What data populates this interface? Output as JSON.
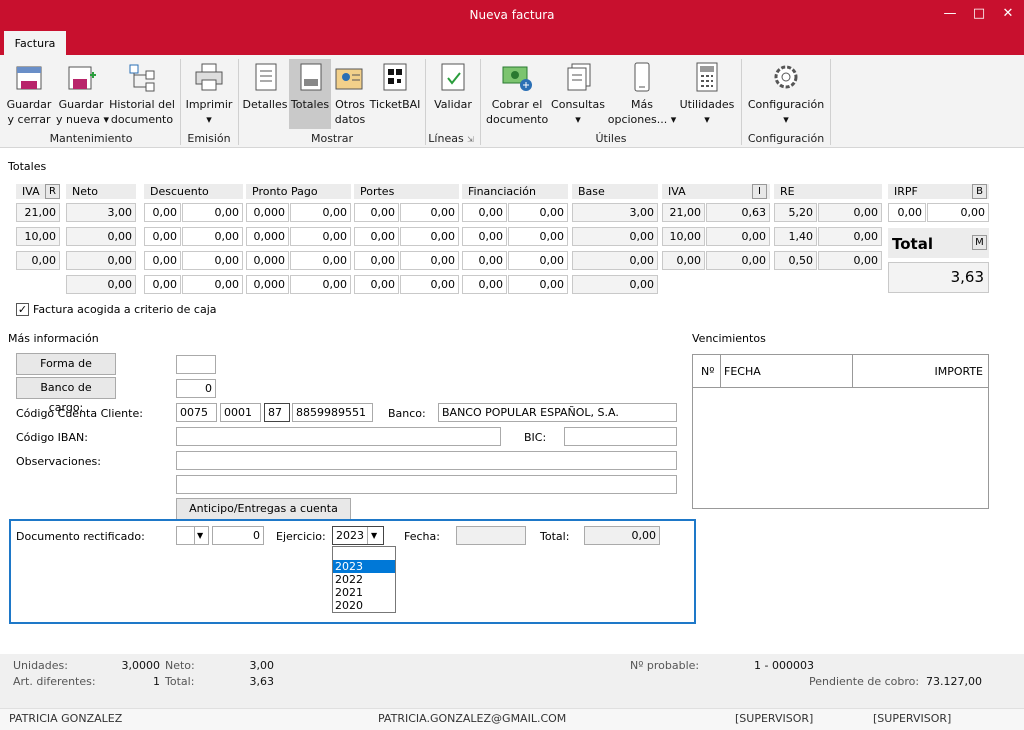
{
  "window": {
    "title": "Nueva factura"
  },
  "tabs": {
    "active": "Factura"
  },
  "ribbon": {
    "guardar_cerrar": "Guardar\ny cerrar",
    "guardar_nueva": "Guardar\ny nueva ▾",
    "historial": "Historial del\ndocumento",
    "imprimir": "Imprimir\n▾",
    "detalles": "Detalles",
    "totales": "Totales",
    "otros_datos": "Otros\ndatos",
    "ticketbai": "TicketBAI",
    "validar": "Validar",
    "cobrar": "Cobrar el\ndocumento",
    "consultas": "Consultas\n▾",
    "mas_opciones": "Más\nopciones... ▾",
    "utilidades": "Utilidades\n▾",
    "configuracion": "Configuración\n▾",
    "groups": {
      "mantenimiento": "Mantenimiento",
      "emision": "Emisión",
      "mostrar": "Mostrar",
      "lineas": "Líneas",
      "utiles": "Útiles",
      "configuracion": "Configuración"
    }
  },
  "totales": {
    "section_title": "Totales",
    "headers": {
      "iva": "IVA",
      "r": "R",
      "neto": "Neto",
      "descuento": "Descuento",
      "pronto_pago": "Pronto Pago",
      "portes": "Portes",
      "financiacion": "Financiación",
      "base": "Base",
      "iva2": "IVA",
      "i": "I",
      "re": "RE",
      "irpf": "IRPF",
      "b": "B"
    },
    "rows": [
      {
        "iva": "21,00",
        "neto": "3,00",
        "d1": "0,00",
        "d2": "0,00",
        "pp1": "0,000",
        "pp2": "0,00",
        "po1": "0,00",
        "po2": "0,00",
        "f1": "0,00",
        "f2": "0,00",
        "base": "3,00",
        "iva_pct": "21,00",
        "iva_imp": "0,63",
        "re_pct": "5,20",
        "re_imp": "0,00"
      },
      {
        "iva": "10,00",
        "neto": "0,00",
        "d1": "0,00",
        "d2": "0,00",
        "pp1": "0,000",
        "pp2": "0,00",
        "po1": "0,00",
        "po2": "0,00",
        "f1": "0,00",
        "f2": "0,00",
        "base": "0,00",
        "iva_pct": "10,00",
        "iva_imp": "0,00",
        "re_pct": "1,40",
        "re_imp": "0,00"
      },
      {
        "iva": "0,00",
        "neto": "0,00",
        "d1": "0,00",
        "d2": "0,00",
        "pp1": "0,000",
        "pp2": "0,00",
        "po1": "0,00",
        "po2": "0,00",
        "f1": "0,00",
        "f2": "0,00",
        "base": "0,00",
        "iva_pct": "0,00",
        "iva_imp": "0,00",
        "re_pct": "0,50",
        "re_imp": "0,00"
      },
      {
        "neto": "0,00",
        "d1": "0,00",
        "d2": "0,00",
        "pp1": "0,000",
        "pp2": "0,00",
        "po1": "0,00",
        "po2": "0,00",
        "f1": "0,00",
        "f2": "0,00",
        "base": "0,00"
      }
    ],
    "irpf_pct": "0,00",
    "irpf_imp": "0,00",
    "total_label": "Total",
    "total_m": "M",
    "total_value": "3,63",
    "criterio_caja": "Factura acogida a criterio de caja"
  },
  "info": {
    "section_title": "Más información",
    "forma_pago_btn": "Forma de pago:",
    "forma_pago_val": "",
    "banco_cargo_btn": "Banco de cargo:",
    "banco_cargo_val": "0",
    "cuenta_label": "Código Cuenta Cliente:",
    "cc1": "0075",
    "cc2": "0001",
    "cc3": "87",
    "cc4": "8859989551",
    "banco_label": "Banco:",
    "banco_val": "BANCO POPULAR ESPAÑOL, S.A.",
    "iban_label": "Código IBAN:",
    "bic_label": "BIC:",
    "obs_label": "Observaciones:",
    "anticipo_btn": "Anticipo/Entregas a cuenta"
  },
  "vencimientos": {
    "title": "Vencimientos",
    "col_n": "Nº",
    "col_fecha": "FECHA",
    "col_importe": "IMPORTE"
  },
  "rectificado": {
    "doc_label": "Documento rectificado:",
    "doc_num": "0",
    "ejercicio_label": "Ejercicio:",
    "ejercicio_val": "2023",
    "fecha_label": "Fecha:",
    "total_label": "Total:",
    "total_val": "0,00",
    "options": [
      "2023",
      "2022",
      "2021",
      "2020"
    ]
  },
  "status": {
    "unidades_l": "Unidades:",
    "unidades_v": "3,0000",
    "neto_l": "Neto:",
    "neto_v": "3,00",
    "art_l": "Art. diferentes:",
    "art_v": "1",
    "total_l": "Total:",
    "total_v": "3,63",
    "nprob_l": "Nº probable:",
    "nprob_v": "1 - 000003",
    "pend_l": "Pendiente de cobro:",
    "pend_v": "73.127,00",
    "user": "PATRICIA GONZALEZ",
    "email": "PATRICIA.GONZALEZ@GMAIL.COM",
    "role1": "[SUPERVISOR]",
    "role2": "[SUPERVISOR]"
  },
  "colors": {
    "accent": "#c8102e",
    "focus_border": "#1e78c8",
    "selected": "#0078d7"
  }
}
